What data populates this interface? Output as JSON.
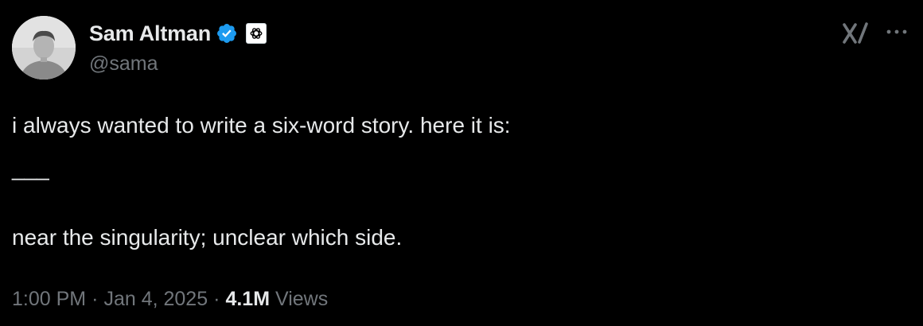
{
  "author": {
    "display_name": "Sam Altman",
    "handle": "@sama",
    "verified_color": "#1d9bf0",
    "avatar_icon": "profile-photo",
    "affiliate_badge_icon": "openai-logo"
  },
  "header_icons": {
    "grok": "grok-icon",
    "more": "more-icon"
  },
  "tweet": {
    "lines": [
      "i always wanted to write a six-word story. here it is:",
      "___",
      "near the singularity; unclear which side."
    ]
  },
  "meta": {
    "time": "1:00 PM",
    "separator": "·",
    "date": "Jan 4, 2025",
    "views_count": "4.1M",
    "views_label": "Views"
  },
  "colors": {
    "background": "#000000",
    "text_primary": "#e7e9ea",
    "text_secondary": "#71767b"
  }
}
